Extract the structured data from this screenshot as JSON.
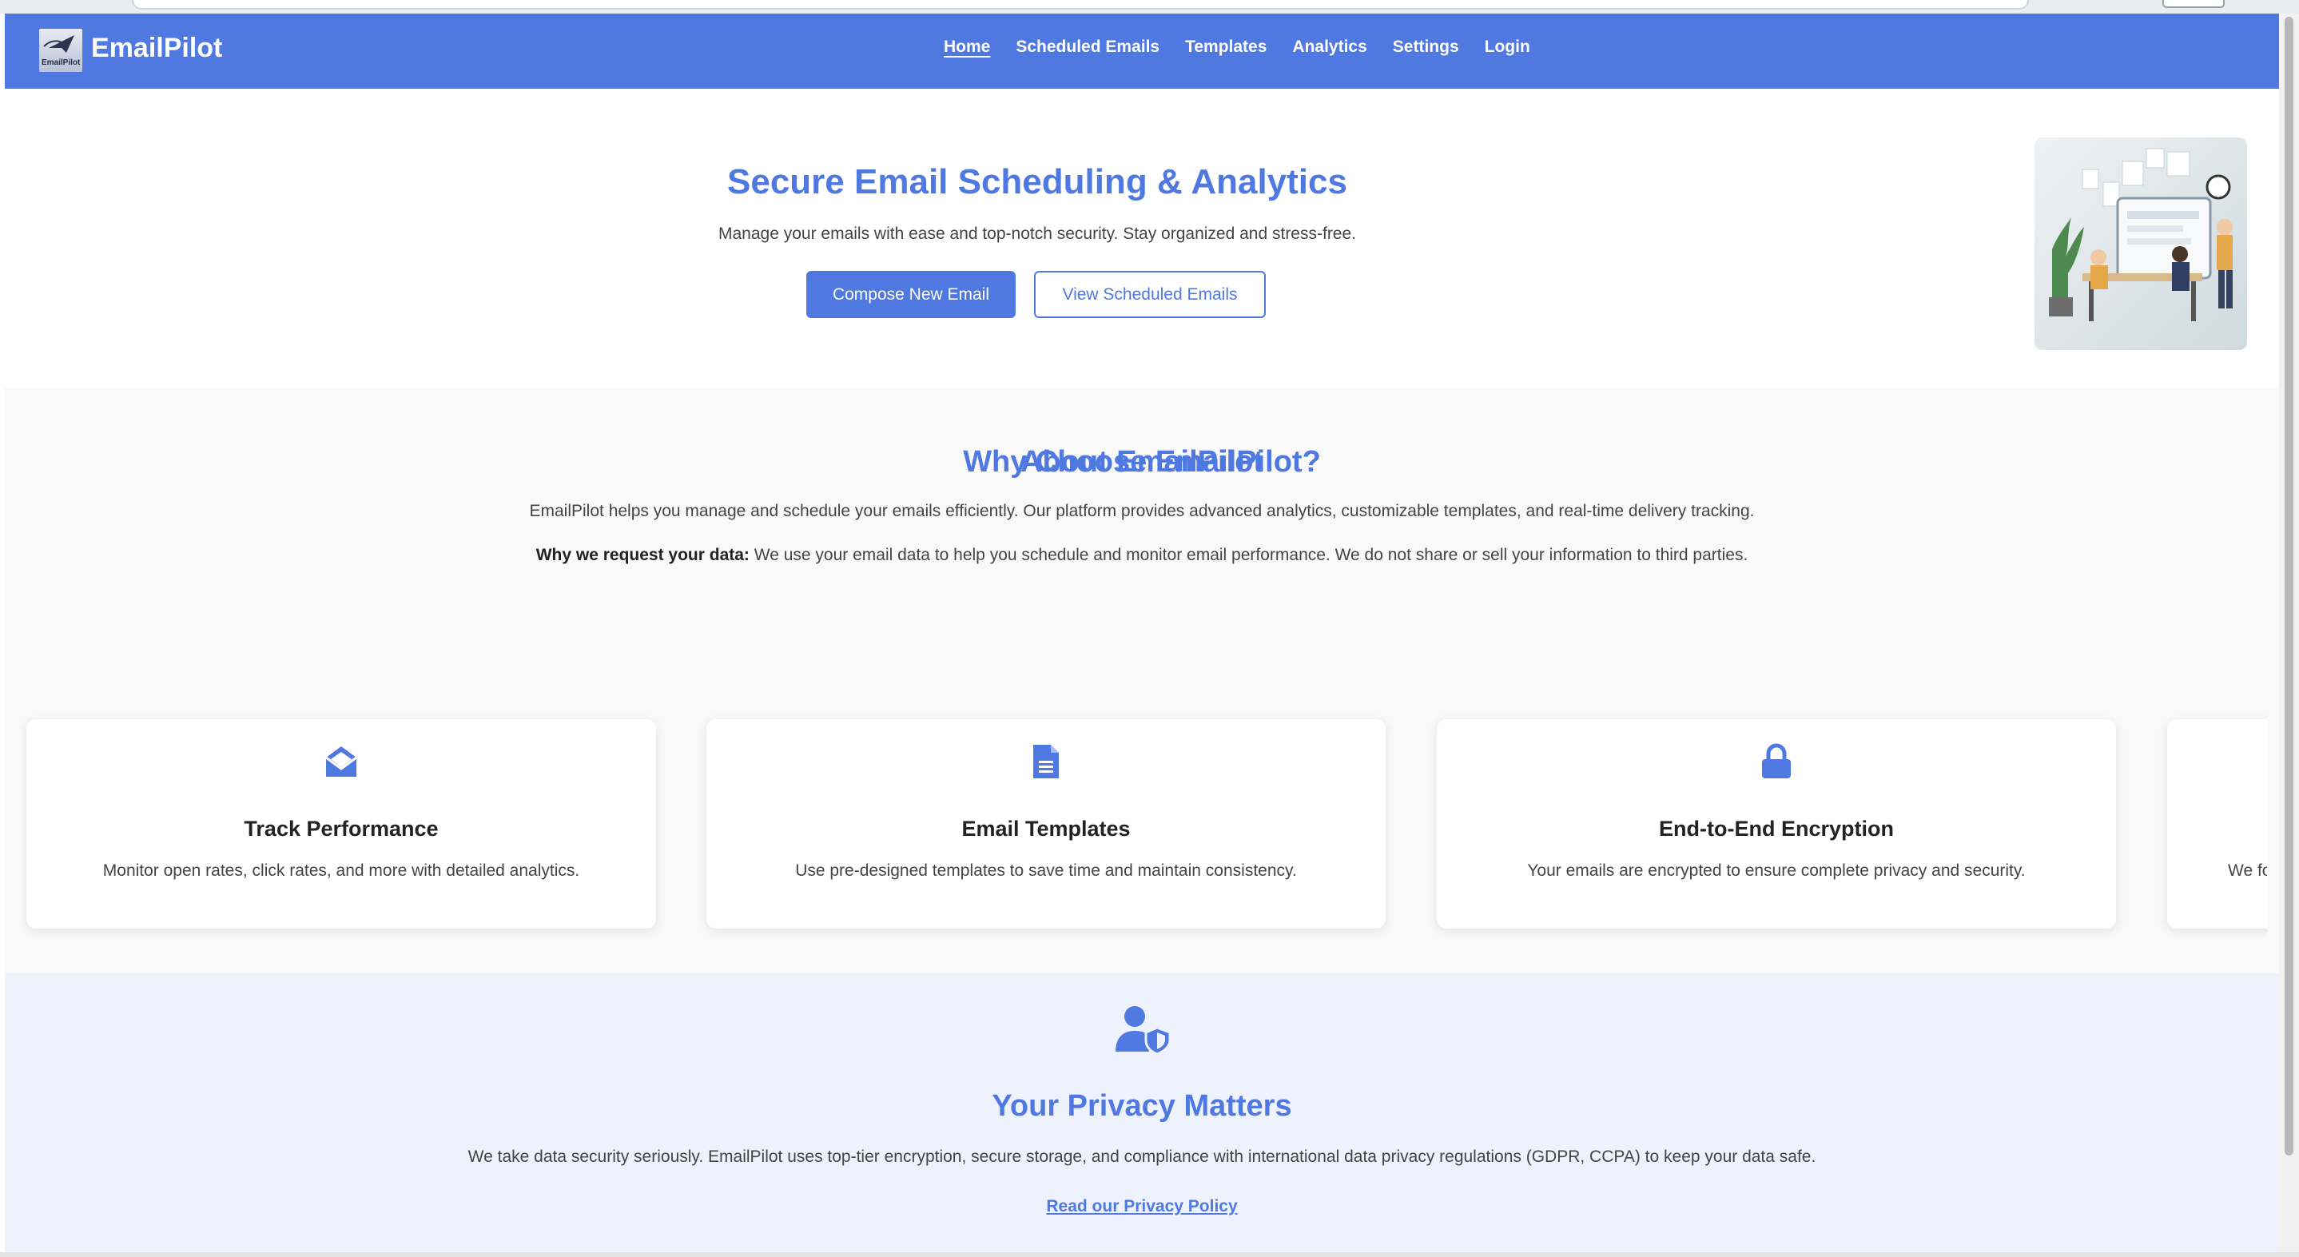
{
  "brand": {
    "name": "EmailPilot",
    "logo_text": "EmailPilot"
  },
  "nav": {
    "items": [
      {
        "label": "Home",
        "active": true
      },
      {
        "label": "Scheduled Emails",
        "active": false
      },
      {
        "label": "Templates",
        "active": false
      },
      {
        "label": "Analytics",
        "active": false
      },
      {
        "label": "Settings",
        "active": false
      },
      {
        "label": "Login",
        "active": false
      }
    ]
  },
  "hero": {
    "title": "Secure Email Scheduling & Analytics",
    "subtitle": "Manage your emails with ease and top-notch security. Stay organized and stress-free.",
    "primary_button": "Compose New Email",
    "secondary_button": "View Scheduled Emails",
    "illustration_icon": "office-illustration"
  },
  "about": {
    "title": "About EmailPilot",
    "text": "EmailPilot helps you manage and schedule your emails efficiently. Our platform provides advanced analytics, customizable templates, and real-time delivery tracking.",
    "data_label": "Why we request your data:",
    "data_text": " We use your email data to help you schedule and monitor email performance. We do not share or sell your information to third parties."
  },
  "features": {
    "title": "Why Choose EmailPilot?",
    "cards": [
      {
        "icon": "envelope-open-icon",
        "title": "Track Performance",
        "desc": "Monitor open rates, click rates, and more with detailed analytics."
      },
      {
        "icon": "document-icon",
        "title": "Email Templates",
        "desc": "Use pre-designed templates to save time and maintain consistency."
      },
      {
        "icon": "lock-icon",
        "title": "End-to-End Encryption",
        "desc": "Your emails are encrypted to ensure complete privacy and security."
      },
      {
        "icon": "",
        "title": "",
        "desc": "We fo"
      }
    ]
  },
  "privacy": {
    "icon": "user-shield-icon",
    "title": "Your Privacy Matters",
    "text": "We take data security seriously. EmailPilot uses top-tier encryption, secure storage, and compliance with international data privacy regulations (GDPR, CCPA) to keep your data safe.",
    "link": "Read our Privacy Policy"
  },
  "colors": {
    "primary": "#4f78e1",
    "privacy_bg": "#eef2fc",
    "section_bg": "#f9f9f9"
  }
}
